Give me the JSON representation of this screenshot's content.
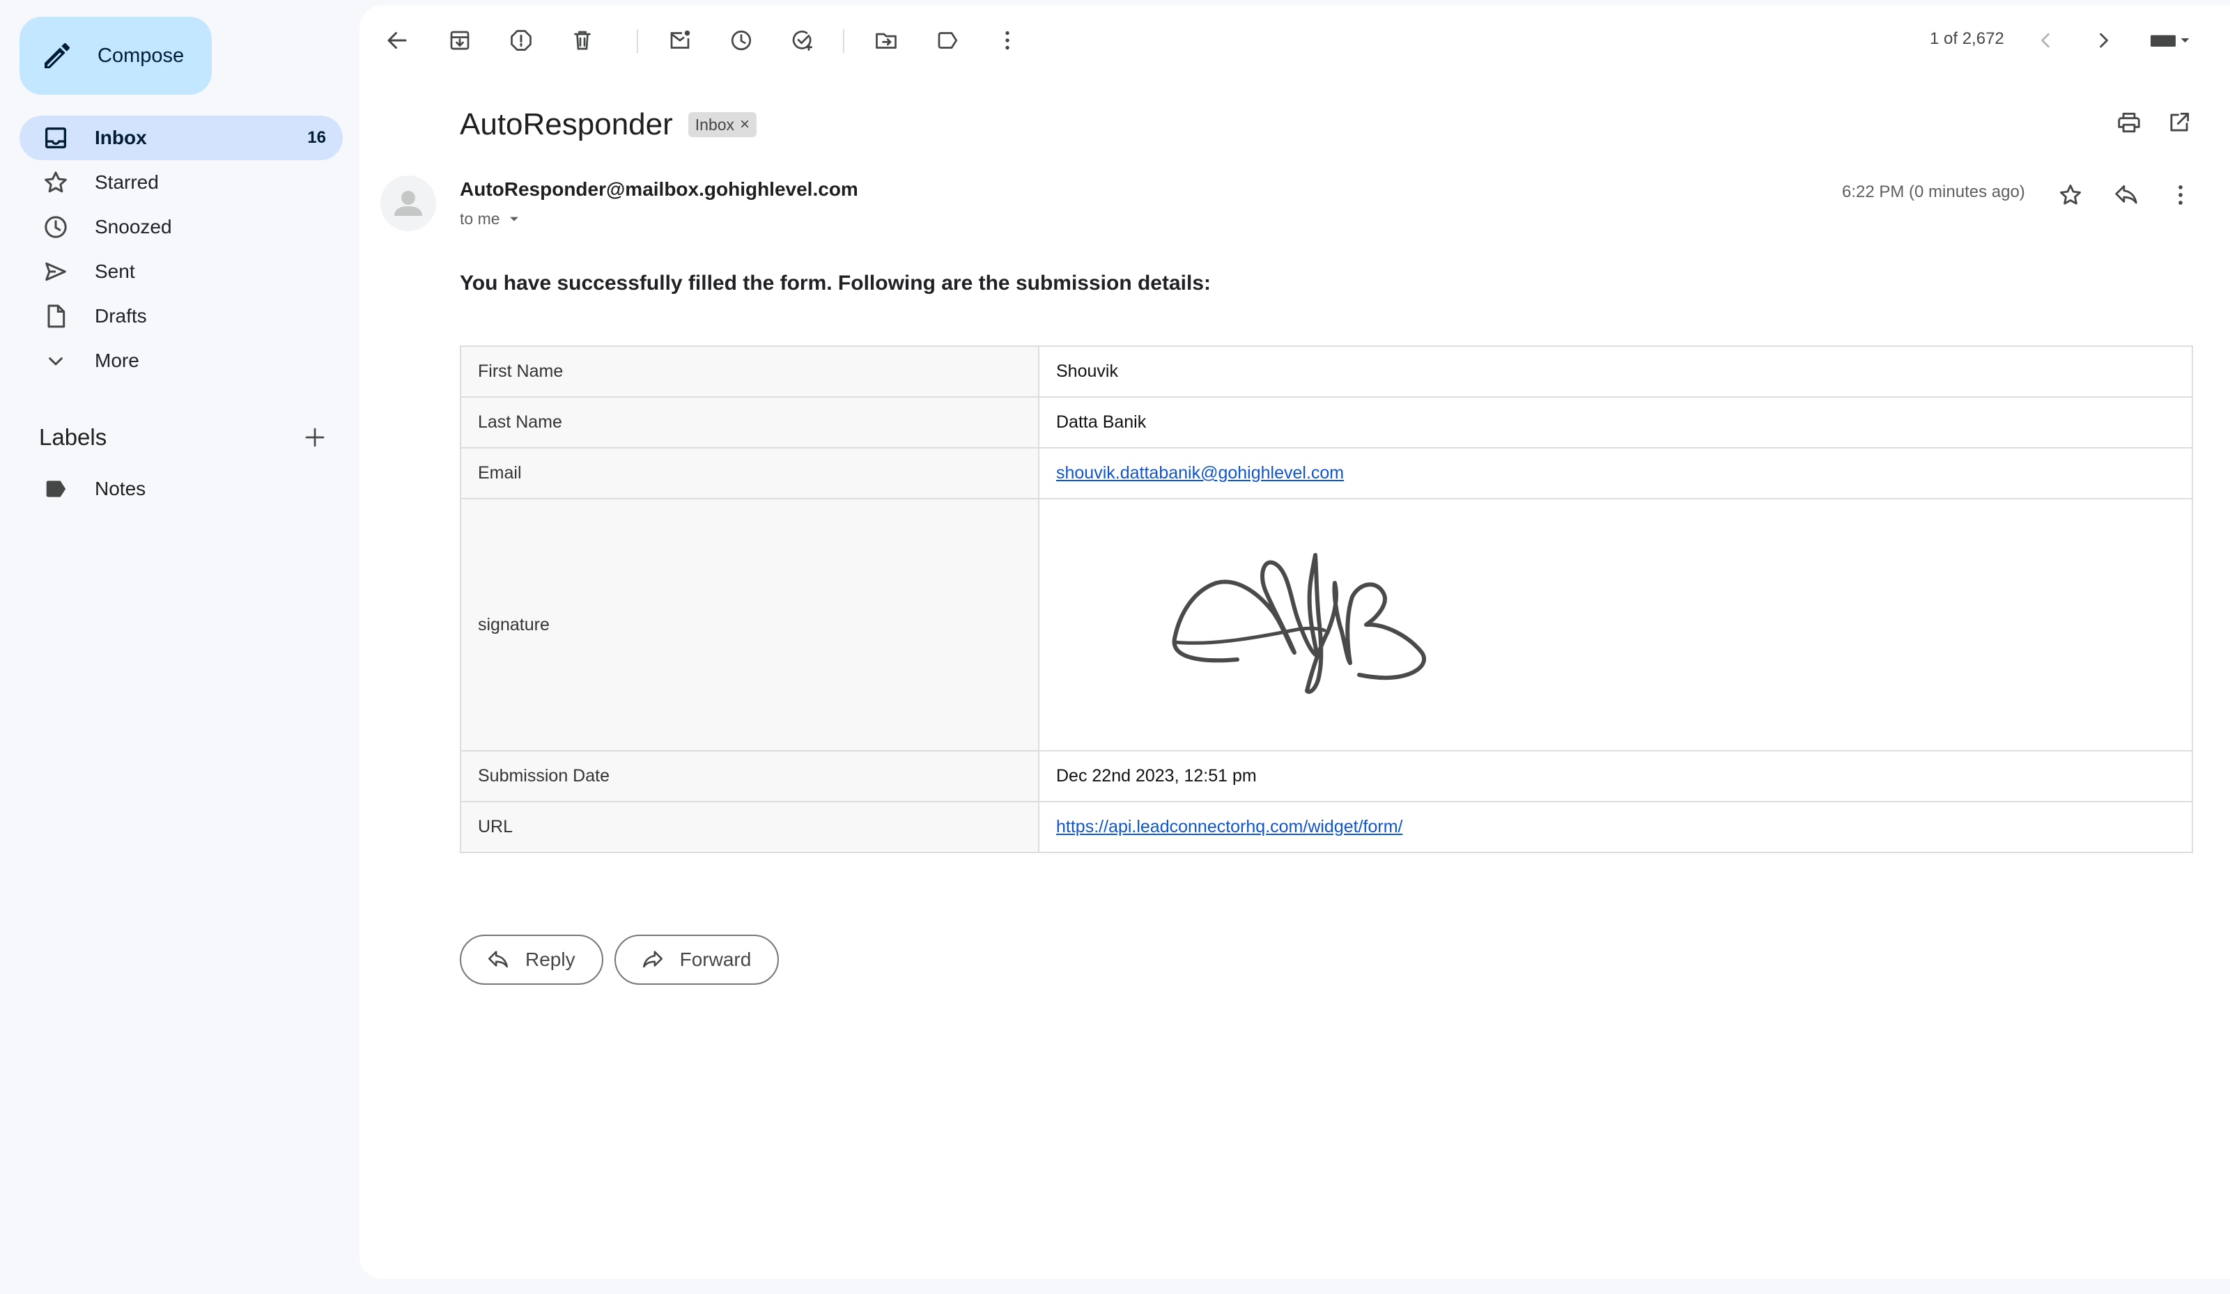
{
  "sidebar": {
    "compose_label": "Compose",
    "items": [
      {
        "label": "Inbox",
        "count": "16",
        "icon": "inbox-icon"
      },
      {
        "label": "Starred",
        "icon": "star-icon"
      },
      {
        "label": "Snoozed",
        "icon": "clock-icon"
      },
      {
        "label": "Sent",
        "icon": "send-icon"
      },
      {
        "label": "Drafts",
        "icon": "draft-icon"
      },
      {
        "label": "More",
        "icon": "chevron-down-icon"
      }
    ],
    "labels_title": "Labels",
    "labels": [
      {
        "label": "Notes",
        "icon": "label-icon"
      }
    ]
  },
  "toolbar": {
    "pager": "1 of 2,672"
  },
  "message": {
    "subject": "AutoResponder",
    "chip": "Inbox",
    "chip_close": "×",
    "sender": "AutoResponder@mailbox.gohighlevel.com",
    "to": "to me",
    "timestamp": "6:22 PM (0 minutes ago)",
    "intro": "You have successfully filled the form. Following are the submission details:",
    "fields": [
      {
        "key": "First Name",
        "value": "Shouvik"
      },
      {
        "key": "Last Name",
        "value": "Datta Banik"
      },
      {
        "key": "Email",
        "value": "shouvik.dattabanik@gohighlevel.com"
      },
      {
        "key": "signature",
        "value": ""
      },
      {
        "key": "Submission Date",
        "value": "Dec 22nd 2023, 12:51 pm"
      },
      {
        "key": "URL",
        "value": "https://api.leadconnectorhq.com/widget/form/"
      }
    ]
  },
  "actions": {
    "reply": "Reply",
    "forward": "Forward"
  }
}
